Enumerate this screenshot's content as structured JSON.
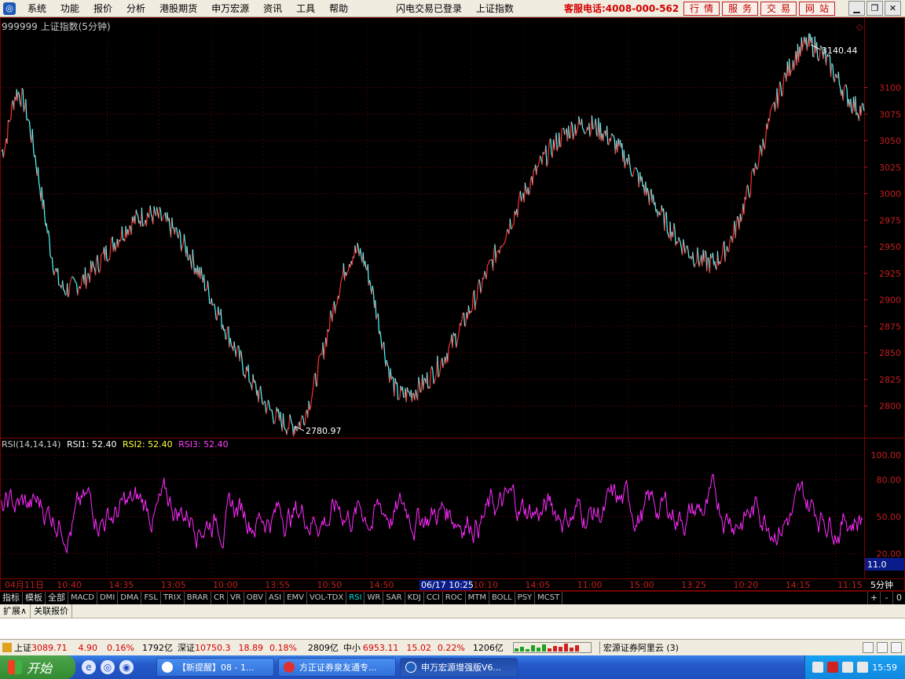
{
  "menubar": {
    "items": [
      "系统",
      "功能",
      "报价",
      "分析",
      "港股期货",
      "申万宏源",
      "资讯",
      "工具",
      "帮助"
    ],
    "status_login": "闪电交易已登录",
    "status_symbol": "上证指数",
    "hotline": "客服电话:4008-000-562",
    "buttons": [
      "行情",
      "服务",
      "交易",
      "网站"
    ]
  },
  "chart": {
    "title": "999999 上证指数(5分钟)",
    "high_label": "3140.44",
    "low_label": "2780.97",
    "price_axis": [
      "3100",
      "3075",
      "3050",
      "3025",
      "3000",
      "2975",
      "2950",
      "2925",
      "2900",
      "2875",
      "2850",
      "2825",
      "2800"
    ],
    "rsi_axis": [
      "100.00",
      "80.00",
      "50.00",
      "20.00"
    ],
    "rsi_current": "11.0",
    "time_axis": [
      "04月11日",
      "10:40",
      "14:35",
      "13:05",
      "10:00",
      "13:55",
      "10:50",
      "14:50",
      "06/17 10:25",
      "10:10",
      "14:05",
      "11:00",
      "15:00",
      "13:25",
      "10:20",
      "14:15",
      "11:15"
    ],
    "time_unit": "5分钟",
    "colors": {
      "up": "#ff3030",
      "down": "#54ffff",
      "rsi": "#ff2bff",
      "grid": "#7a0000",
      "axis": "#c41e1e"
    }
  },
  "chart_data": {
    "type": "line",
    "title": "999999 上证指数(5分钟)",
    "price_panel": {
      "ylim": [
        2770,
        3150
      ],
      "key_points": [
        {
          "label": "start",
          "value": 3040
        },
        {
          "label": "early_high",
          "value": 3095
        },
        {
          "label": "drop",
          "value": 2910
        },
        {
          "label": "rebound",
          "value": 2980
        },
        {
          "label": "low",
          "value": 2780.97
        },
        {
          "label": "mid_high",
          "value": 2945
        },
        {
          "label": "dip",
          "value": 2810
        },
        {
          "label": "rally",
          "value": 3065
        },
        {
          "label": "pullback",
          "value": 2935
        },
        {
          "label": "high",
          "value": 3140.44
        },
        {
          "label": "end",
          "value": 3078
        }
      ]
    },
    "rsi_panel": {
      "legend": "RSI(14,14,14)",
      "series": [
        {
          "name": "RSI1",
          "value": 52.4
        },
        {
          "name": "RSI2",
          "value": 52.4
        },
        {
          "name": "RSI3",
          "value": 52.4
        }
      ],
      "ylim": [
        0,
        100
      ]
    }
  },
  "rsi_legend": {
    "params": "RSI(14,14,14)",
    "rsi1": "RSI1: 52.40",
    "rsi2": "RSI2: 52.40",
    "rsi3": "RSI3: 52.40"
  },
  "indicator_tabs": [
    "指标",
    "模板",
    "全部",
    "MACD",
    "DMI",
    "DMA",
    "FSL",
    "TRIX",
    "BRAR",
    "CR",
    "VR",
    "OBV",
    "ASI",
    "EMV",
    "VOL-TDX",
    "RSI",
    "WR",
    "SAR",
    "KDJ",
    "CCI",
    "ROC",
    "MTM",
    "BOLL",
    "PSY",
    "MCST"
  ],
  "tab_controls": [
    "+",
    "-",
    "0"
  ],
  "ext_tabs": [
    "扩展∧",
    "关联报价"
  ],
  "ticker": {
    "sh_name": "上证",
    "sh_value": "3089.71",
    "sh_change": "4.90",
    "sh_pct": "0.16%",
    "sh_amount": "1792亿",
    "sz_name": "深证",
    "sz_value": "10750.3",
    "sz_change": "18.89",
    "sz_pct": "0.18%",
    "sz_amount": "2809亿",
    "zx_name": "中小",
    "zx_value": "6953.11",
    "zx_change": "15.02",
    "zx_pct": "0.22%",
    "zx_amount": "1206亿",
    "broker": "宏源证券阿里云 (3)"
  },
  "taskbar": {
    "start": "开始",
    "tasks": [
      "【新提醒】08 - 1...",
      "方正证券泉友通专...",
      "申万宏源增强版V6..."
    ],
    "clock": "15:59"
  }
}
